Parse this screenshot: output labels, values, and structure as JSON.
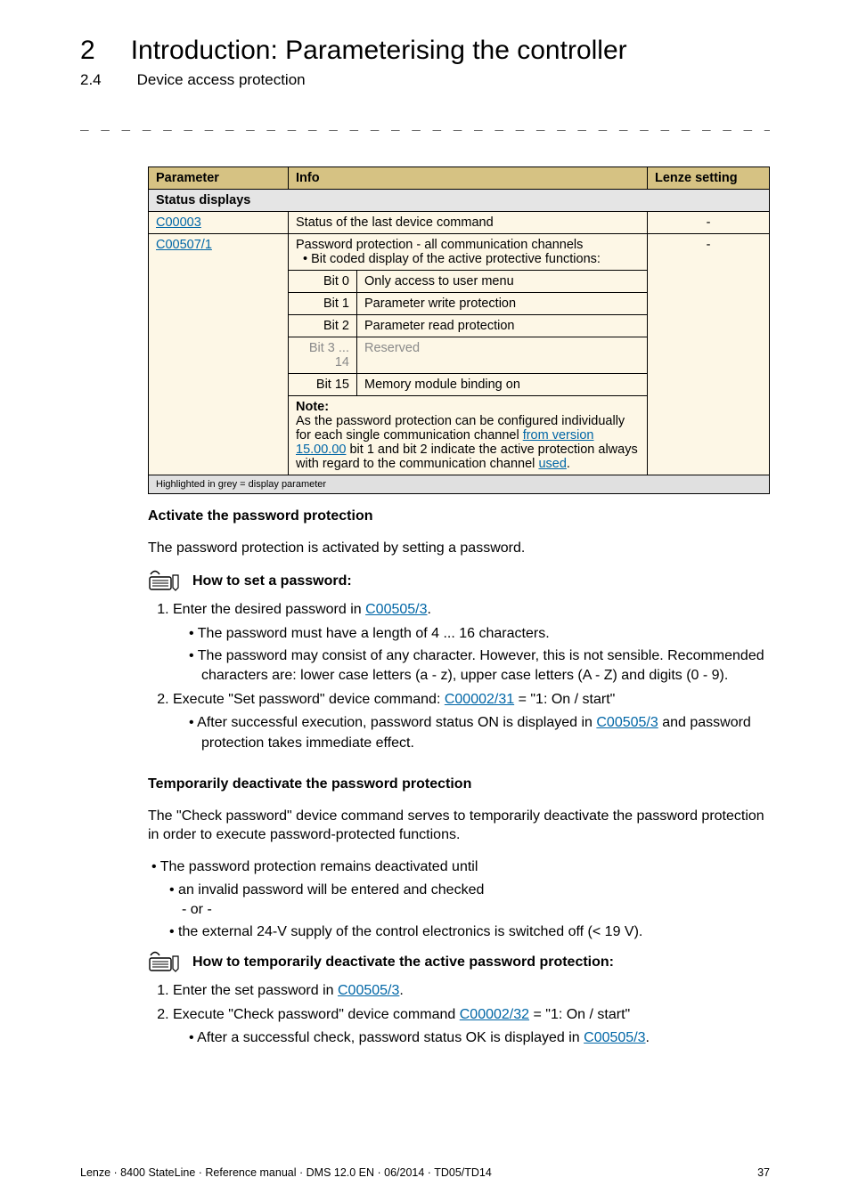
{
  "header": {
    "chapter_num": "2",
    "chapter_title": "Introduction: Parameterising the controller",
    "section_num": "2.4",
    "section_title": "Device access protection"
  },
  "table": {
    "head": {
      "param": "Parameter",
      "info": "Info",
      "lenze": "Lenze setting"
    },
    "group": "Status displays",
    "row1": {
      "param": "C00003",
      "info": "Status of the last device command",
      "lenze": "-"
    },
    "row2": {
      "param": "C00507/1",
      "info_line1": "Password protection - all communication channels",
      "info_line2": "• Bit coded display of the active protective functions:",
      "lenze": "-"
    },
    "bits": {
      "b0": {
        "lbl": "Bit 0",
        "txt": "Only access to user menu"
      },
      "b1": {
        "lbl": "Bit 1",
        "txt": "Parameter write protection"
      },
      "b2": {
        "lbl": "Bit 2",
        "txt": "Parameter read protection"
      },
      "b3": {
        "lbl": "Bit 3 ... 14",
        "txt": "Reserved"
      },
      "b4": {
        "lbl": "Bit 15",
        "txt": "Memory module binding on"
      }
    },
    "note": {
      "label": "Note:",
      "l1": "As the password protection can be configured individually for each single communication channel ",
      "l1_ver": "from version 15.00.00",
      "l1_cont": " bit 1 and bit 2 indicate the active protection always with regard to the communication channel ",
      "l1_used": "used",
      "l1_end": "."
    },
    "footnote": "Highlighted in grey = display parameter"
  },
  "activate": {
    "heading": "Activate the password protection",
    "intro": "The password protection is activated by setting a password.",
    "howto": "How to set a password:",
    "step1_a": "Enter the desired password in ",
    "step1_link": "C00505/3",
    "step1_b": ".",
    "s1_b1": "The password must have a length of 4 ... 16 characters.",
    "s1_b2": "The password may consist of any character. However, this is not sensible. Recommended characters are: lower case letters (a - z), upper case letters (A - Z) and digits (0 - 9).",
    "step2_a": "Execute \"Set password\" device command: ",
    "step2_link": "C00002/31",
    "step2_b": " = \"1: On / start\"",
    "s2_b1_a": "After successful execution, password status ON is displayed in ",
    "s2_b1_link": "C00505/3",
    "s2_b1_b": " and password protection takes immediate effect."
  },
  "temp": {
    "heading": "Temporarily deactivate the password protection",
    "intro": "The \"Check password\" device command serves to temporarily deactivate the password protection in order to execute password-protected functions.",
    "b1": "The password protection remains deactivated until",
    "b1_1": "an invalid password will be entered and checked",
    "b1_or": "- or -",
    "b1_2": "the external 24-V supply of the control electronics is switched off (< 19 V).",
    "howto": "How to temporarily deactivate the active password protection:",
    "step1_a": "Enter the set password in ",
    "step1_link": "C00505/3",
    "step1_b": ".",
    "step2_a": "Execute \"Check password\" device command ",
    "step2_link": "C00002/32",
    "step2_b": "  = \"1: On / start\"",
    "s2_b1_a": "After a successful check, password status OK is displayed in ",
    "s2_b1_link": "C00505/3",
    "s2_b1_b": "."
  },
  "footer": {
    "left": "Lenze · 8400 StateLine · Reference manual · DMS 12.0 EN · 06/2014 · TD05/TD14",
    "right": "37"
  }
}
